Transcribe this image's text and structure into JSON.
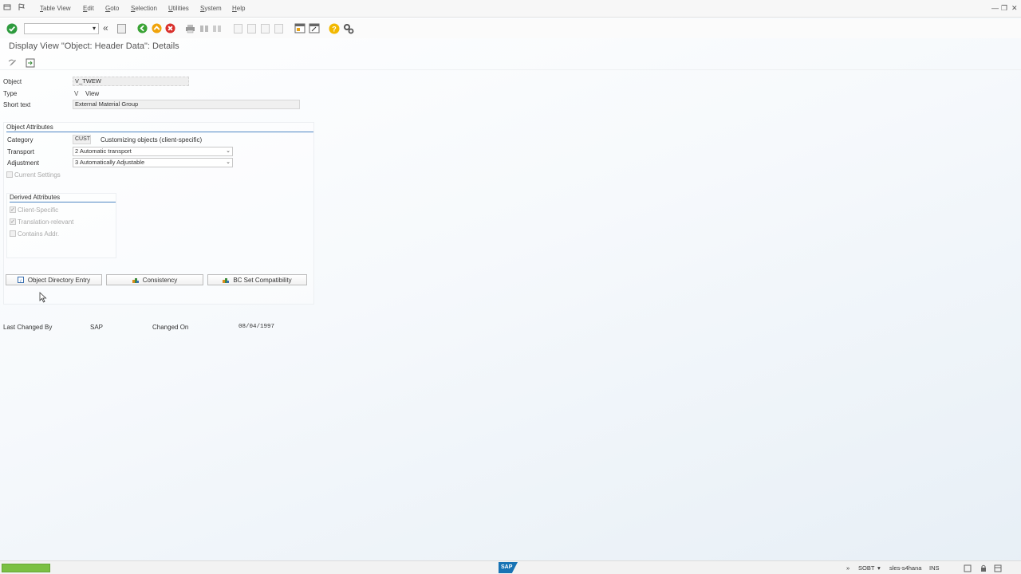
{
  "menu": {
    "items": [
      {
        "id": "table-view",
        "prefix": "T",
        "rest": "able View"
      },
      {
        "id": "edit",
        "prefix": "E",
        "rest": "dit"
      },
      {
        "id": "goto",
        "prefix": "G",
        "rest": "oto"
      },
      {
        "id": "selection",
        "prefix": "S",
        "rest": "election"
      },
      {
        "id": "utilities",
        "prefix": "U",
        "rest": "tilities"
      },
      {
        "id": "system",
        "prefix": "S",
        "rest": "ystem"
      },
      {
        "id": "help",
        "prefix": "H",
        "rest": "elp"
      }
    ]
  },
  "window_controls": {
    "minimize": "—",
    "restore": "❐",
    "close": "✕"
  },
  "toolbar": {
    "command_field_value": "",
    "command_field_arrow": "▾",
    "back_double": "«"
  },
  "title": "Display View \"Object: Header Data\": Details",
  "header_fields": {
    "object_label": "Object",
    "object_value": "V_TWEW",
    "type_label": "Type",
    "type_code": "V",
    "type_text": "View",
    "short_text_label": "Short text",
    "short_text_value": "External Material Group"
  },
  "object_attributes": {
    "title": "Object Attributes",
    "category_label": "Category",
    "category_code": "CUST",
    "category_text": "Customizing objects (client-specific)",
    "transport_label": "Transport",
    "transport_value": "2 Automatic transport",
    "adjustment_label": "Adjustment",
    "adjustment_value": "3 Automatically Adjustable",
    "current_settings_label": "Current Settings",
    "current_settings_checked": false
  },
  "derived_attributes": {
    "title": "Derived Attributes",
    "items": [
      {
        "label": "Client-Specific",
        "checked": true,
        "mark": "✓"
      },
      {
        "label": "Translation-relevant",
        "checked": true,
        "mark": "✓"
      },
      {
        "label": "Contains Addr.",
        "checked": false,
        "mark": ""
      }
    ]
  },
  "buttons": {
    "object_directory": "Object Directory Entry",
    "consistency": "Consistency",
    "bc_set": "BC Set Compatibility"
  },
  "footer_info": {
    "last_changed_by_label": "Last Changed By",
    "last_changed_by_value": "SAP",
    "changed_on_label": "Changed On",
    "changed_on_value": "08/04/1997"
  },
  "statusbar": {
    "logo": "SAP",
    "arrows": "»",
    "system": "SOBT",
    "dropdown": "▾",
    "server": "sles-s4hana",
    "mode": "INS"
  },
  "colors": {
    "ok_green": "#2e9b3e",
    "nav_green": "#3aa335",
    "nav_orange": "#f0a30a",
    "cancel_red": "#d9302c",
    "help_yellow": "#f2b800",
    "progress_green": "#7bc043",
    "accent_blue": "#4e86c4"
  }
}
